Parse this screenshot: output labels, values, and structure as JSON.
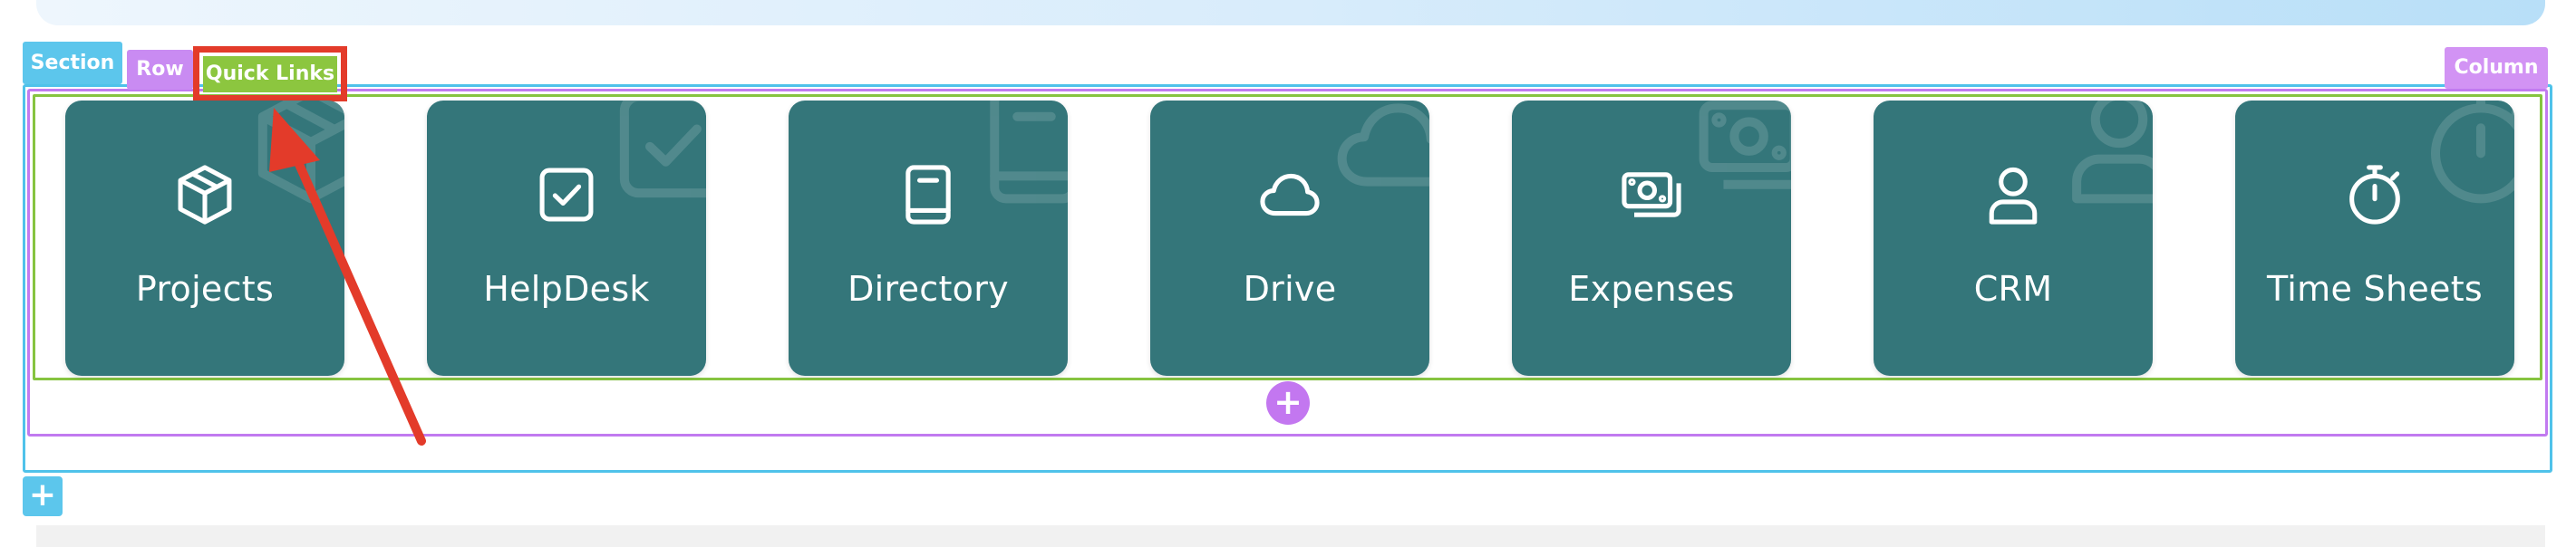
{
  "builder": {
    "section_tag": "Section",
    "row_tag": "Row",
    "module_tag": "Quick Links",
    "column_tag": "Column",
    "add_row_symbol": "+",
    "add_section_symbol": "+"
  },
  "quick_links": [
    {
      "label": "Projects",
      "icon": "box-icon"
    },
    {
      "label": "HelpDesk",
      "icon": "check-square-icon"
    },
    {
      "label": "Directory",
      "icon": "book-icon"
    },
    {
      "label": "Drive",
      "icon": "cloud-icon"
    },
    {
      "label": "Expenses",
      "icon": "money-icon"
    },
    {
      "label": "CRM",
      "icon": "user-icon"
    },
    {
      "label": "Time Sheets",
      "icon": "stopwatch-icon"
    }
  ],
  "colors": {
    "card_bg": "#34767a",
    "section_accent": "#4fc2ea",
    "row_accent": "#c17af0",
    "column_accent": "#86c440",
    "annotation_red": "#e33b2a"
  }
}
